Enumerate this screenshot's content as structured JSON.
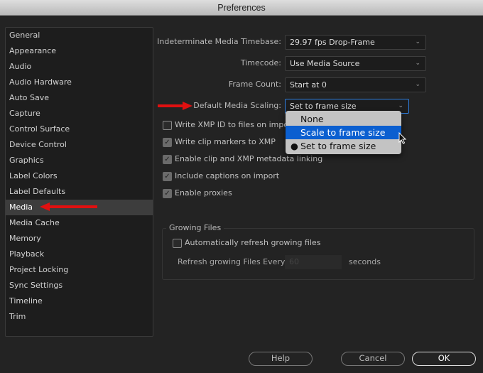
{
  "window": {
    "title": "Preferences"
  },
  "sidebar": {
    "items": [
      "General",
      "Appearance",
      "Audio",
      "Audio Hardware",
      "Auto Save",
      "Capture",
      "Control Surface",
      "Device Control",
      "Graphics",
      "Label Colors",
      "Label Defaults",
      "Media",
      "Media Cache",
      "Memory",
      "Playback",
      "Project Locking",
      "Sync Settings",
      "Timeline",
      "Trim"
    ],
    "selected": "Media"
  },
  "settings": {
    "timebase": {
      "label": "Indeterminate Media Timebase:",
      "value": "29.97 fps Drop-Frame"
    },
    "timecode": {
      "label": "Timecode:",
      "value": "Use Media Source"
    },
    "frame_count": {
      "label": "Frame Count:",
      "value": "Start at 0"
    },
    "scaling": {
      "label": "Default Media Scaling:",
      "value": "Set to frame size",
      "options": [
        "None",
        "Scale to frame size",
        "Set to frame size"
      ],
      "highlighted": "Scale to frame size",
      "checked": "Set to frame size"
    }
  },
  "checkboxes": [
    {
      "label": "Write XMP ID to files on import",
      "checked": false
    },
    {
      "label": "Write clip markers to XMP",
      "checked": true
    },
    {
      "label": "Enable clip and XMP metadata linking",
      "checked": true
    },
    {
      "label": "Include captions on import",
      "checked": true
    },
    {
      "label": "Enable proxies",
      "checked": true
    }
  ],
  "growing": {
    "title": "Growing Files",
    "auto_label": "Automatically refresh growing files",
    "auto_checked": false,
    "refresh_label": "Refresh growing Files Every",
    "refresh_value": "60",
    "unit": "seconds"
  },
  "buttons": {
    "help": "Help",
    "cancel": "Cancel",
    "ok": "OK"
  },
  "colors": {
    "accent": "#0b5fd0",
    "annotation_arrow": "#e01010"
  }
}
